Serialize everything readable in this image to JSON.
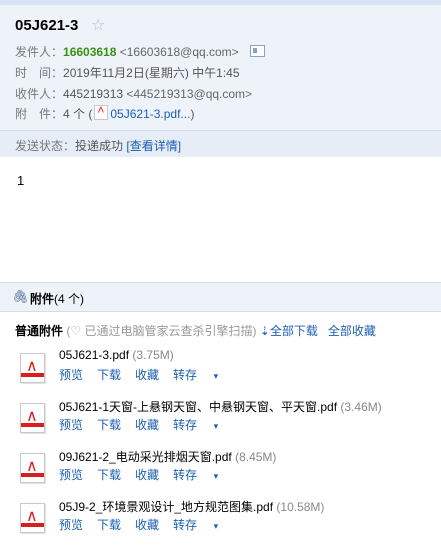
{
  "email": {
    "subject": "05J621-3",
    "sender_label": "发件人：",
    "sender_name": "16603618",
    "sender_addr": "<16603618@qq.com>",
    "time_label": "时　间：",
    "time_value": "2019年11月2日(星期六) 中午1:45",
    "recipient_label": "收件人：",
    "recipient_name": "445219313",
    "recipient_addr": "<445219313@qq.com>",
    "attach_label": "附　件：",
    "attach_count": "4 个",
    "attach_preview": "05J621-3.pdf...",
    "paren_open": "(",
    "paren_close": ")",
    "status_label": "发送状态：",
    "status_value": "投递成功",
    "status_link": "[查看详情]",
    "body": "1"
  },
  "attachments": {
    "title": "附件",
    "count": "(4 个)",
    "section_label": "普通附件",
    "scan_note": "(♡ 已通过电脑管家云查杀引擎扫描)",
    "download_all": "全部下载",
    "save_all": "全部收藏",
    "actions": {
      "preview": "预览",
      "download": "下载",
      "save": "收藏",
      "forward": "转存"
    },
    "files": [
      {
        "name": "05J621-3.pdf",
        "size": "(3.75M)"
      },
      {
        "name": "05J621-1天窗-上悬钢天窗、中悬钢天窗、平天窗.pdf",
        "size": "(3.46M)"
      },
      {
        "name": "09J621-2_电动采光排烟天窗.pdf",
        "size": "(8.45M)"
      },
      {
        "name": "05J9-2_环境景观设计_地方规范图集.pdf",
        "size": "(10.58M)"
      }
    ]
  },
  "colors": {
    "header_bg": "#eef3fa",
    "link": "#1c5fb1",
    "sender": "#3a8e12",
    "pdf_red": "#d81e1e"
  }
}
